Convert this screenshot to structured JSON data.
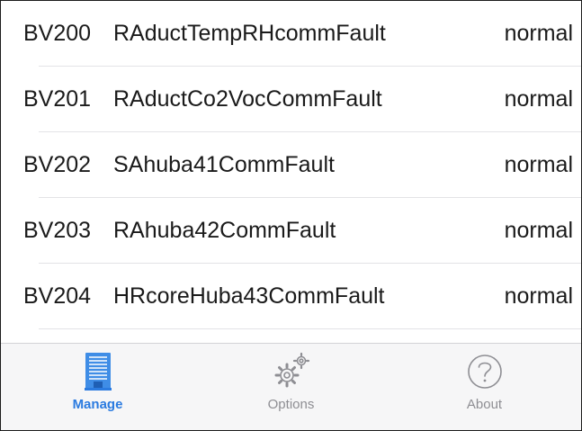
{
  "list": {
    "rows": [
      {
        "id": "BV200",
        "name": "RAductTempRHcommFault",
        "status": "normal"
      },
      {
        "id": "BV201",
        "name": "RAductCo2VocCommFault",
        "status": "normal"
      },
      {
        "id": "BV202",
        "name": "SAhuba41CommFault",
        "status": "normal"
      },
      {
        "id": "BV203",
        "name": "RAhuba42CommFault",
        "status": "normal"
      },
      {
        "id": "BV204",
        "name": "HRcoreHuba43CommFault",
        "status": "normal"
      }
    ]
  },
  "tabbar": {
    "active_color": "#2b7be0",
    "inactive_color": "#8e8e93",
    "tabs": [
      {
        "label": "Manage",
        "icon": "building-icon",
        "active": true
      },
      {
        "label": "Options",
        "icon": "gears-icon",
        "active": false
      },
      {
        "label": "About",
        "icon": "question-circle-icon",
        "active": false
      }
    ]
  }
}
